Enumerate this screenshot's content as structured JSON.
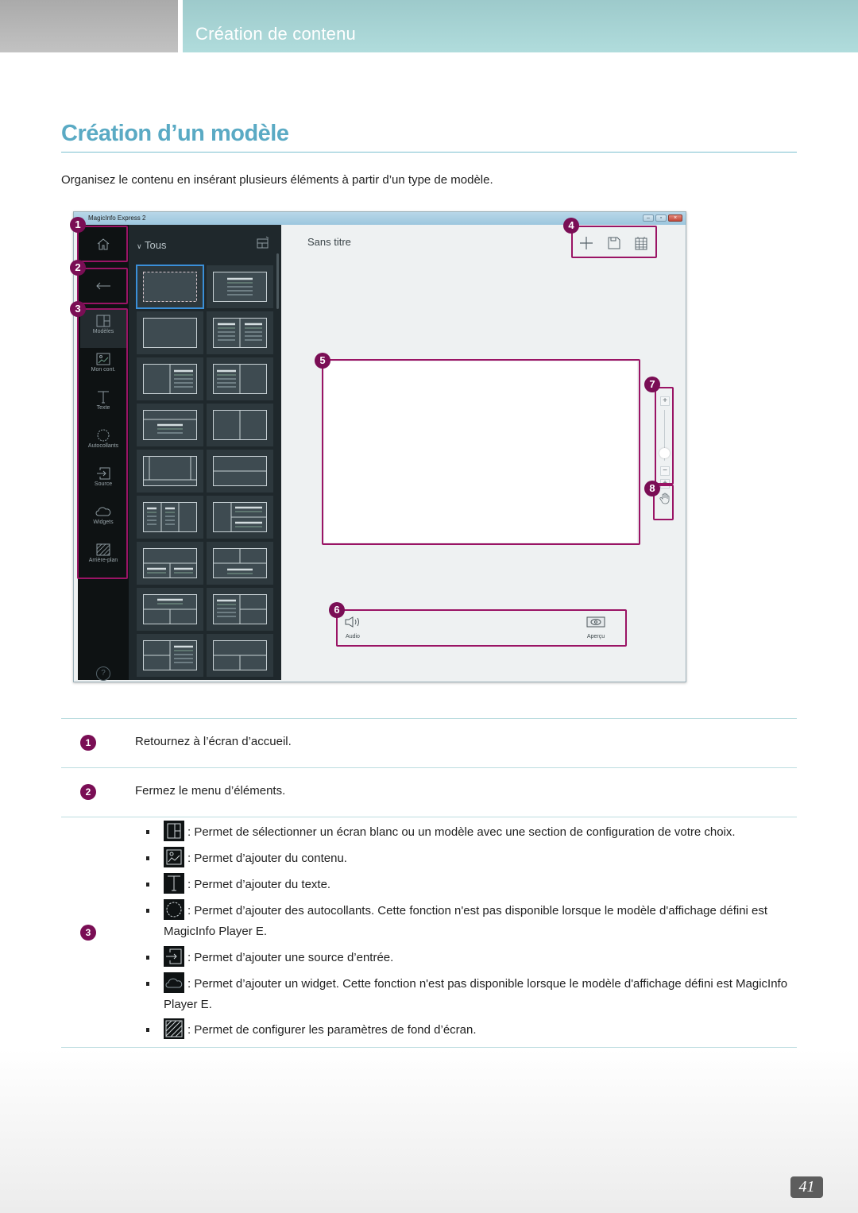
{
  "header": {
    "section_title": "Création de contenu"
  },
  "page": {
    "title": "Création d’un modèle",
    "intro": "Organisez le contenu en insérant plusieurs éléments à partir d’un type de modèle.",
    "page_number": "41"
  },
  "app": {
    "window_title": "MagicInfo Express 2",
    "window_controls": [
      "minimize",
      "maximize",
      "close"
    ],
    "nav": {
      "home_icon": "home-icon",
      "back_icon": "arrow-left-icon",
      "items": [
        {
          "label": "Modèles",
          "icon": "layout-icon",
          "active": true
        },
        {
          "label": "Mon cont.",
          "icon": "image-icon",
          "active": false
        },
        {
          "label": "Texte",
          "icon": "text-icon",
          "active": false
        },
        {
          "label": "Autocollants",
          "icon": "sticker-icon",
          "active": false
        },
        {
          "label": "Source",
          "icon": "source-icon",
          "active": false
        },
        {
          "label": "Widgets",
          "icon": "cloud-icon",
          "active": false
        },
        {
          "label": "Arrière-plan",
          "icon": "background-icon",
          "active": false
        }
      ],
      "help_label": "?"
    },
    "templates": {
      "filter_label": "Tous",
      "items": [
        "blank",
        "title-lines",
        "single",
        "two-col-text",
        "left-image-right-text",
        "left-text-right-image",
        "header-body",
        "two-col",
        "three-col-footer",
        "two-row",
        "three-col-text",
        "left-two-right-text",
        "top-two-bottom",
        "top-two-cols-bottom",
        "top-bottom-two",
        "text-left-two-right",
        "two-left-text-right",
        "top-two-bottom-split"
      ],
      "selected_index": 0
    },
    "document_title": "Sans titre",
    "toolbar": {
      "new_icon": "plus-icon",
      "save_icon": "save-icon",
      "schedule_icon": "calendar-icon"
    },
    "zoom": {
      "plus": "+",
      "minus": "−",
      "level": 0.15
    },
    "pan": {
      "fit": "+",
      "hand_icon": "hand-icon"
    },
    "bottom_bar": {
      "audio_label": "Audio",
      "preview_label": "Aperçu"
    }
  },
  "callouts": [
    "1",
    "2",
    "3",
    "4",
    "5",
    "6",
    "7",
    "8"
  ],
  "descriptions": [
    {
      "num": "1",
      "text": "Retournez à l’écran d’accueil."
    },
    {
      "num": "2",
      "text": "Fermez le menu d’éléments."
    },
    {
      "num": "3"
    }
  ],
  "features": [
    {
      "icon": "layout-icon",
      "text": ": Permet de sélectionner un écran blanc ou un modèle avec une section de configuration de votre choix."
    },
    {
      "icon": "image-icon",
      "text": ": Permet d’ajouter du contenu."
    },
    {
      "icon": "text-icon",
      "text": ": Permet d’ajouter du texte."
    },
    {
      "icon": "sticker-icon",
      "text": ": Permet d’ajouter des autocollants. Cette fonction n'est pas disponible lorsque le modèle d'affichage défini est MagicInfo Player E."
    },
    {
      "icon": "source-icon",
      "text": ": Permet d’ajouter une source d’entrée."
    },
    {
      "icon": "cloud-icon",
      "text": ": Permet d’ajouter un widget. Cette fonction n'est pas disponible lorsque le modèle d'affichage défini est MagicInfo Player E."
    },
    {
      "icon": "background-icon",
      "text": ": Permet de configurer les paramètres de fond d’écran."
    }
  ],
  "colors": {
    "accent": "#5aaac4",
    "callout": "#7a0e55",
    "highlight": "#9a1465",
    "selected": "#3a8fd8"
  }
}
